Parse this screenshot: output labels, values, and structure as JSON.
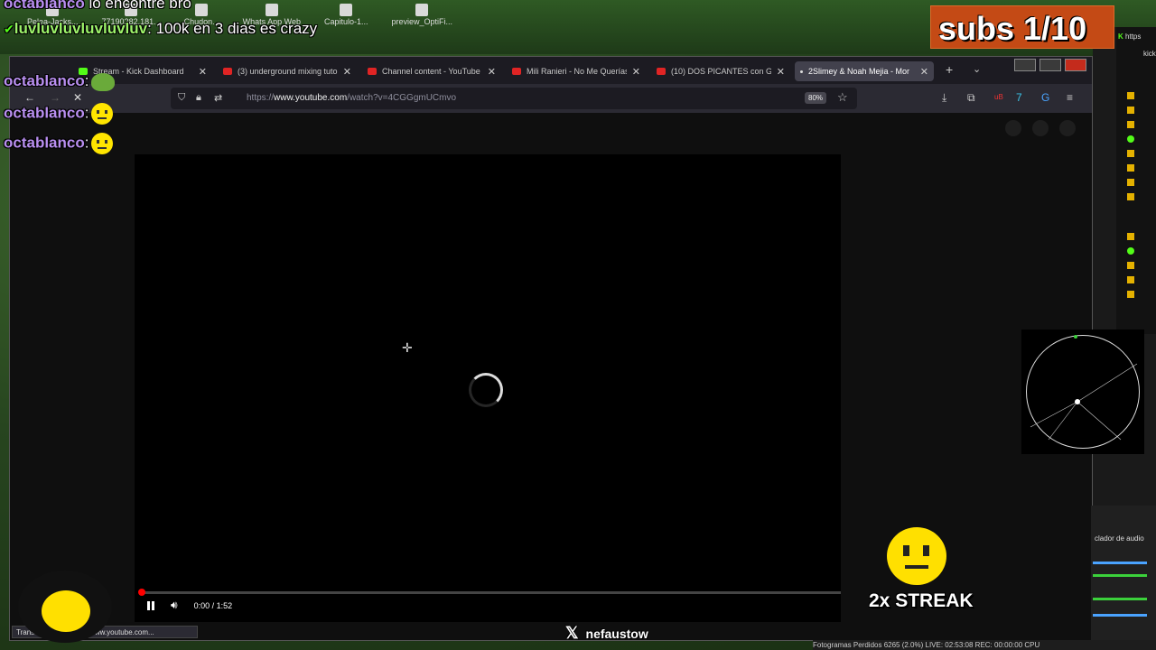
{
  "desktop": {
    "icons": [
      "Pelea-Jacks...",
      "77190282.181...",
      "Chudon...",
      "Whats App Web",
      "Capitulo-1...",
      "preview_OptiFi..."
    ]
  },
  "browser": {
    "tabs": [
      {
        "label": "Stream - Kick Dashboard",
        "favicon": "kick-icon"
      },
      {
        "label": "(3) underground mixing tuto",
        "favicon": "youtube-icon"
      },
      {
        "label": "Channel content - YouTube S",
        "favicon": "youtube-icon"
      },
      {
        "label": "Mili Ranieri - No Me Querías",
        "favicon": "youtube-icon"
      },
      {
        "label": "(10) DOS PICANTES con GO",
        "favicon": "youtube-icon"
      },
      {
        "label": "2Slimey & Noah Mejia - Mor",
        "favicon": "dot",
        "active": true
      }
    ],
    "url_prefix": "https://",
    "url_host": "www.youtube.com",
    "url_path": "/watch?v=4CGGgmUCmvo",
    "zoom": "80%",
    "status_text": "Transferring data from www.youtube.com..."
  },
  "player": {
    "time": "0:00 / 1:52",
    "progress": 0.0
  },
  "chat_overlay": [
    {
      "user": "octablanco",
      "text": " lo encontre bro",
      "color": "#b98ff0"
    },
    {
      "user": "luvluvluvluvluvluv",
      "text": " 100k en 3 dias es crazy",
      "color": "#9df36a"
    },
    {
      "user": "octablanco",
      "text": ":",
      "color": "#b98ff0",
      "emote": "pepe"
    },
    {
      "user": "octablanco",
      "text": ":",
      "color": "#b98ff0",
      "emote": "neutral-face"
    },
    {
      "user": "octablanco",
      "text": ":",
      "color": "#b98ff0",
      "emote": "neutral-face"
    }
  ],
  "overlay": {
    "subs": "subs 1/10",
    "streak": "2x STREAK",
    "social_handle": "nefaustow"
  },
  "side_panel": {
    "url_snip": "https",
    "kick_snip": "kick",
    "mixer_title": "clador de audio",
    "obs_status": "Fotogramas Perdidos 6265 (2.0%)   LIVE: 02:53:08   REC: 00:00:00   CPU"
  },
  "colors": {
    "accent_red": "#ff0000",
    "kick_green": "#53fc18",
    "subs_bg": "#c44a15"
  }
}
